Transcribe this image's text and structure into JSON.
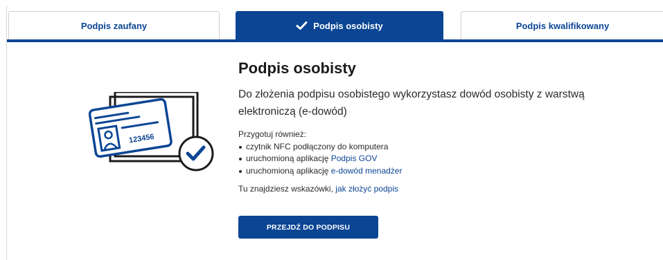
{
  "tabs": [
    {
      "label": "Podpis zaufany",
      "active": false
    },
    {
      "label": "Podpis osobisty",
      "active": true
    },
    {
      "label": "Podpis kwalifikowany",
      "active": false
    }
  ],
  "illustration": {
    "card_number": "123456"
  },
  "main": {
    "title": "Podpis osobisty",
    "lead": "Do złożenia podpisu osobistego wykorzystasz dowód osobisty z warstwą elektroniczą (e-dowód)",
    "prepare_label": "Przygotuj również:",
    "requirements": [
      {
        "text": "czytnik NFC podłączony do komputera",
        "link": ""
      },
      {
        "text": "uruchomioną aplikację ",
        "link": "Podpis GOV"
      },
      {
        "text": "uruchomioną aplikację ",
        "link": "e-dowód menadżer"
      }
    ],
    "hint_text": "Tu znajdziesz wskazówki, ",
    "hint_link": "jak złożyć podpis",
    "button_label": "PRZEJDŹ DO PODPISU"
  },
  "colors": {
    "primary": "#0b4594",
    "text": "#1b1b1b",
    "border": "#cfcfcf"
  }
}
